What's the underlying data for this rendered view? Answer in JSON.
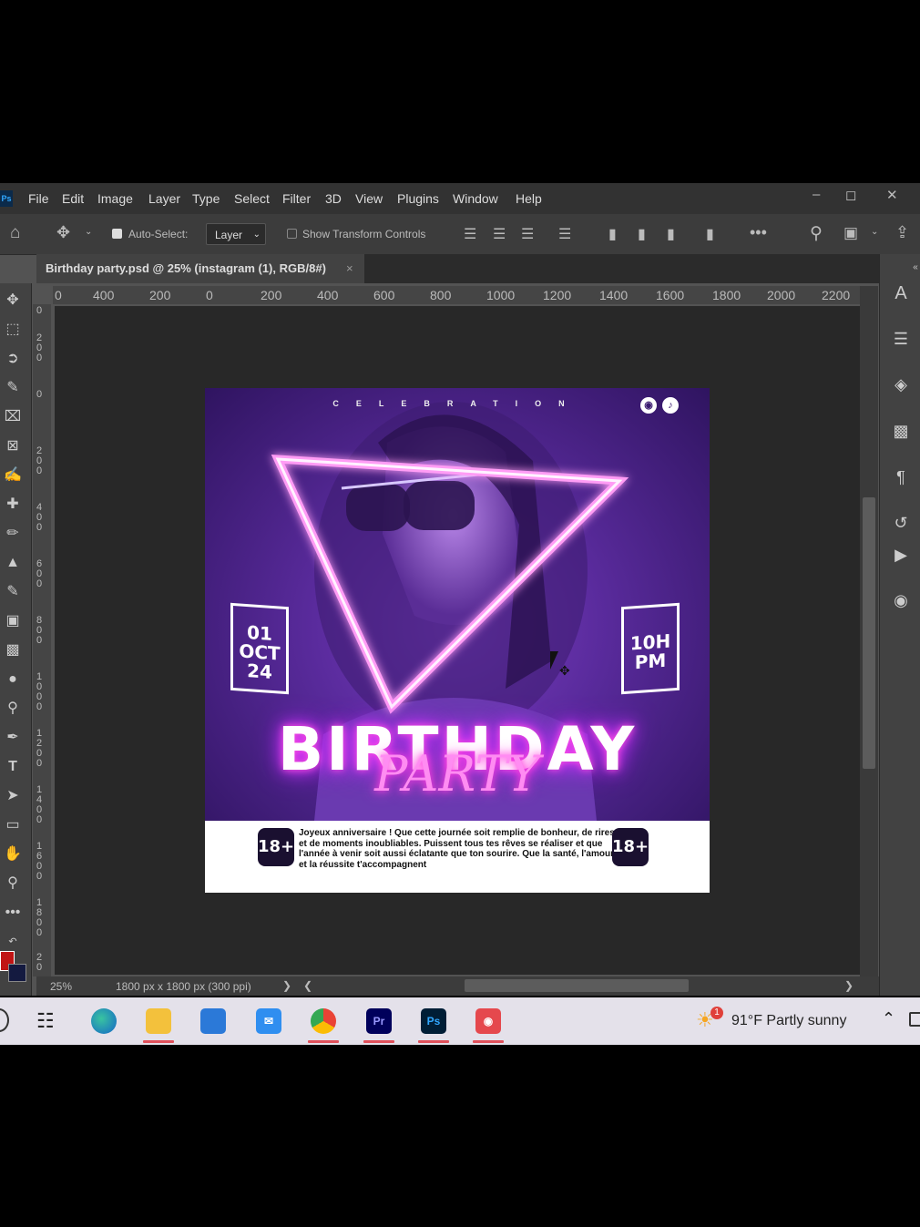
{
  "menubar": {
    "app_logo": "Ps",
    "items": [
      "File",
      "Edit",
      "Image",
      "Layer",
      "Type",
      "Select",
      "Filter",
      "3D",
      "View",
      "Plugins",
      "Window",
      "Help"
    ]
  },
  "options_bar": {
    "auto_select_label": "Auto-Select:",
    "auto_select_checked": true,
    "auto_select_target": "Layer",
    "show_transform_label": "Show Transform Controls",
    "show_transform_checked": false
  },
  "document_tab": {
    "title": "Birthday party.psd @ 25% (instagram (1), RGB/8#)",
    "close": "×"
  },
  "ruler": {
    "h_ticks": [
      "0",
      "400",
      "200",
      "0",
      "200",
      "400",
      "600",
      "800",
      "1000",
      "1200",
      "1400",
      "1600",
      "1800",
      "2000",
      "2200"
    ],
    "v_ticks": [
      "0",
      "2 0 0",
      "0",
      "2 0 0",
      "4 0 0",
      "6 0 0",
      "8 0 0",
      "1 0 0 0",
      "1 2 0 0",
      "1 4 0 0",
      "1 6 0 0",
      "1 8 0 0",
      "2 0"
    ]
  },
  "status_bar": {
    "zoom": "25%",
    "doc_info": "1800 px x 1800 px (300 ppi)"
  },
  "colors": {
    "foreground": "#c01414",
    "background": "#141a40",
    "accent": "#e23bff"
  },
  "poster": {
    "tagline": "CELEBRATION",
    "social_icons": [
      "instagram-icon",
      "tiktok-icon"
    ],
    "date_lines": [
      "01",
      "OCT",
      "24"
    ],
    "time_lines": [
      "10H",
      "PM"
    ],
    "title": "BIRTHDAY",
    "subtitle": "PARTY",
    "age_badge": "18+",
    "message": "Joyeux anniversaire ! Que cette journée soit remplie de bonheur, de rires et de moments inoubliables. Puissent tous tes rêves se réaliser et que l'année à venir soit aussi éclatante que ton sourire. Que la santé, l'amour et la réussite t'accompagnent"
  },
  "taskbar": {
    "apps": [
      "edge-icon",
      "file-explorer-icon",
      "store-icon",
      "mail-icon",
      "chrome-icon",
      "premiere-icon",
      "photoshop-icon",
      "screen-recorder-icon"
    ],
    "premiere_label": "Pr",
    "photoshop_label": "Ps",
    "weather_badge": "1",
    "weather": "91°F  Partly sunny"
  }
}
